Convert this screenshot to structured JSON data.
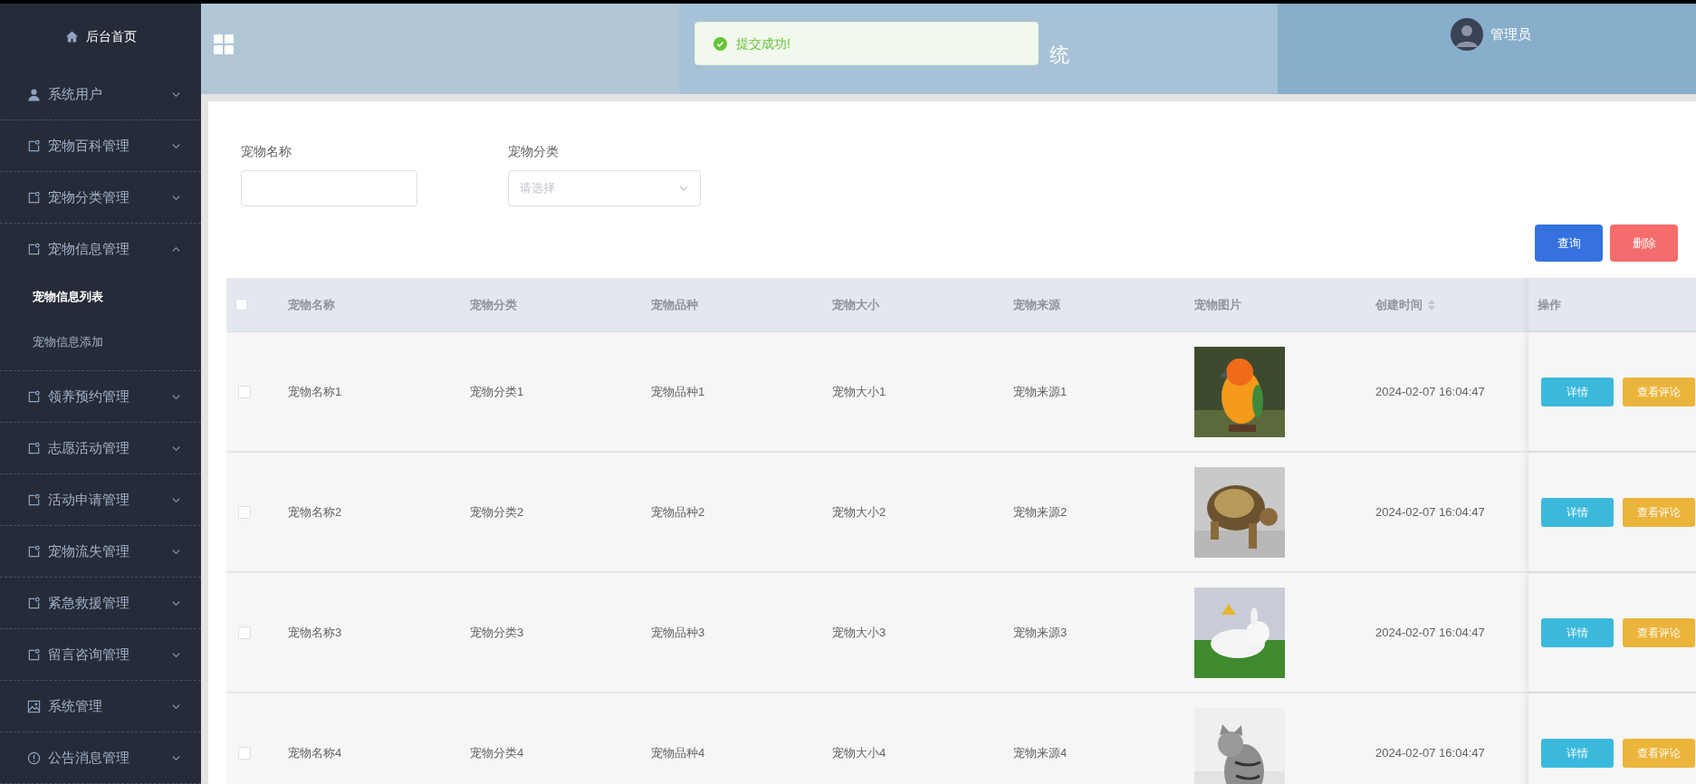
{
  "sidebar": {
    "home": "后台首页",
    "items": [
      {
        "label": "系统用户",
        "expanded": false
      },
      {
        "label": "宠物百科管理",
        "expanded": false
      },
      {
        "label": "宠物分类管理",
        "expanded": false
      },
      {
        "label": "宠物信息管理",
        "expanded": true,
        "children": [
          {
            "label": "宠物信息列表",
            "selected": true
          },
          {
            "label": "宠物信息添加",
            "selected": false
          }
        ]
      },
      {
        "label": "领养预约管理",
        "expanded": false
      },
      {
        "label": "志愿活动管理",
        "expanded": false
      },
      {
        "label": "活动申请管理",
        "expanded": false
      },
      {
        "label": "宠物流失管理",
        "expanded": false
      },
      {
        "label": "紧急救援管理",
        "expanded": false
      },
      {
        "label": "留言咨询管理",
        "expanded": false
      },
      {
        "label": "系统管理",
        "expanded": false
      },
      {
        "label": "公告消息管理",
        "expanded": false
      }
    ]
  },
  "header": {
    "title": "统",
    "user": "管理员"
  },
  "toast": {
    "message": "提交成功!"
  },
  "search": {
    "fields": [
      {
        "label": "宠物名称",
        "kind": "input"
      },
      {
        "label": "宠物分类",
        "kind": "select",
        "placeholder": "请选择"
      }
    ],
    "buttons": [
      {
        "label": "查询",
        "kind": "primary"
      },
      {
        "label": "删除",
        "kind": "danger"
      }
    ]
  },
  "table": {
    "select_all": {
      "checked": false
    },
    "columns": [
      {
        "label": "宠物名称",
        "sortable": false
      },
      {
        "label": "宠物分类",
        "sortable": false
      },
      {
        "label": "宠物品种",
        "sortable": false
      },
      {
        "label": "宠物大小",
        "sortable": false
      },
      {
        "label": "宠物来源",
        "sortable": false
      },
      {
        "label": "宠物图片",
        "sortable": false
      },
      {
        "label": "创建时间",
        "sortable": true
      },
      {
        "label": "操作",
        "sortable": false
      }
    ],
    "rows": [
      {
        "checked": false,
        "cells": [
          "宠物名称1",
          "宠物分类1",
          "宠物品种1",
          "宠物大小1",
          "宠物来源1"
        ],
        "created": "2024-02-07 16:04:47",
        "actions": [
          "详情",
          "查看评论"
        ]
      },
      {
        "checked": false,
        "cells": [
          "宠物名称2",
          "宠物分类2",
          "宠物品种2",
          "宠物大小2",
          "宠物来源2"
        ],
        "created": "2024-02-07 16:04:47",
        "actions": [
          "详情",
          "查看评论"
        ]
      },
      {
        "checked": false,
        "cells": [
          "宠物名称3",
          "宠物分类3",
          "宠物品种3",
          "宠物大小3",
          "宠物来源3"
        ],
        "created": "2024-02-07 16:04:47",
        "actions": [
          "详情",
          "查看评论"
        ]
      },
      {
        "checked": false,
        "cells": [
          "宠物名称4",
          "宠物分类4",
          "宠物品种4",
          "宠物大小4",
          "宠物来源4"
        ],
        "created": "2024-02-07 16:04:47",
        "actions": [
          "详情",
          "查看评论"
        ]
      }
    ]
  }
}
